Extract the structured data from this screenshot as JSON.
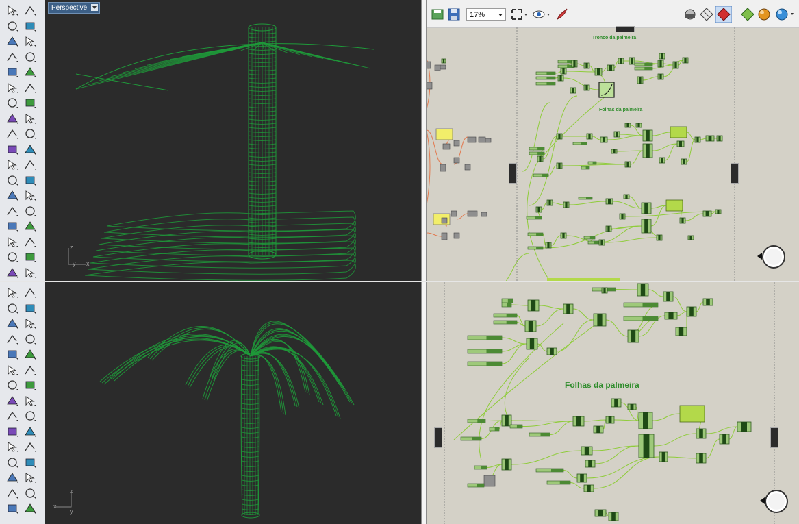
{
  "viewport_top": {
    "label": "Perspective",
    "axis_z": "z",
    "axis_x": "x",
    "axis_y": "y"
  },
  "viewport_bottom": {
    "axis_z": "z",
    "axis_x": "x",
    "axis_y": "y"
  },
  "grasshopper": {
    "zoom": "17%",
    "group_tronco": "Tronco da palmeira",
    "group_folhas_small": "Folhas da palmeira",
    "group_folhas_large": "Folhas da palmeira"
  },
  "colors": {
    "viewport_bg": "#2b2b2b",
    "wire_green": "#1f9a3a",
    "canvas_bg": "#d4d1c7",
    "gh_wire": "#9ad03a",
    "gh_group_text": "#2e8c2b",
    "panel_yellow": "#f2ee6a",
    "orange_wire": "#e27a50"
  }
}
